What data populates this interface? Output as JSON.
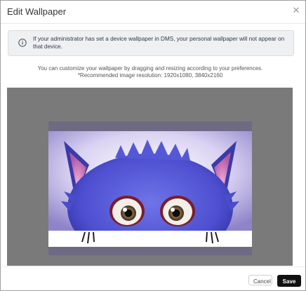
{
  "dialog": {
    "title": "Edit Wallpaper",
    "close_icon": "close-icon"
  },
  "alert": {
    "icon": "info-icon",
    "text": "If your administrator has set a device wallpaper in DMS, your personal wallpaper will not appear on that device."
  },
  "description": {
    "line1": "You can customize your wallpaper by dragging and resizing according to your preferences.",
    "line2": "*Recommended image resolution: 1920x1080, 3840x2160"
  },
  "editor": {
    "canvas_color": "#7a7a7a",
    "image_subject": "furry-blue-monster-wallpaper"
  },
  "footer": {
    "cancel_label": "Cancel",
    "save_label": "Save"
  },
  "colors": {
    "primary_button": "#111111",
    "alert_background": "#eef0f2"
  }
}
